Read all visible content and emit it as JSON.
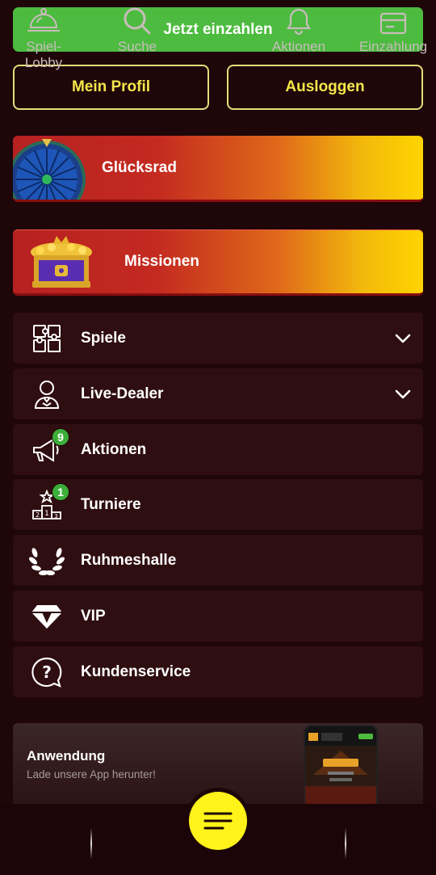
{
  "top": {
    "deposit_label": "Jetzt einzahlen",
    "profile_label": "Mein Profil",
    "logout_label": "Ausloggen"
  },
  "promos": {
    "wheel_label": "Glücksrad",
    "missions_label": "Missionen"
  },
  "menu": [
    {
      "label": "Spiele",
      "icon": "puzzle-icon",
      "expandable": true
    },
    {
      "label": "Live-Dealer",
      "icon": "dealer-icon",
      "expandable": true
    },
    {
      "label": "Aktionen",
      "icon": "megaphone-icon",
      "badge": "9"
    },
    {
      "label": "Turniere",
      "icon": "podium-icon",
      "badge": "1"
    },
    {
      "label": "Ruhmeshalle",
      "icon": "laurel-icon"
    },
    {
      "label": "VIP",
      "icon": "diamond-icon"
    },
    {
      "label": "Kundenservice",
      "icon": "help-icon"
    }
  ],
  "app_card": {
    "title": "Anwendung",
    "subtitle": "Lade unsere App herunter!"
  },
  "bottom_nav": {
    "lobby_line1": "Spiel-",
    "lobby_line2": "Lobby",
    "search": "Suche",
    "promotions": "Aktionen",
    "deposit": "Einzahlung"
  },
  "colors": {
    "background": "#1f0609",
    "deposit_green": "#4dbb3f",
    "accent_yellow": "#f4e64a",
    "menu_bg": "#2f0e11",
    "badge_green": "#3cae3a",
    "center_button": "#fff31a"
  }
}
